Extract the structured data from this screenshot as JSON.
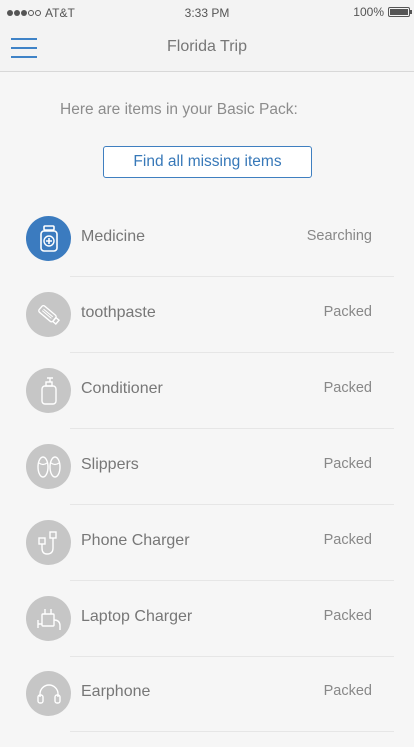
{
  "status_bar": {
    "carrier": "AT&T",
    "signal_bars_filled": 3,
    "signal_bars_total": 5,
    "time": "3:33 PM",
    "battery": "100%"
  },
  "nav": {
    "title": "Florida Trip",
    "menu_icon": "hamburger-menu-icon"
  },
  "intro_text": "Here are items in your Basic Pack:",
  "find_button_label": "Find all missing items",
  "colors": {
    "accent": "#3b7bbf",
    "icon_inactive": "#c6c6c6",
    "background": "#f6f6f6"
  },
  "items": [
    {
      "name": "Medicine",
      "status": "Searching",
      "icon": "medicine-bottle-icon",
      "active": true
    },
    {
      "name": "toothpaste",
      "status": "Packed",
      "icon": "toothpaste-icon",
      "active": false
    },
    {
      "name": "Conditioner",
      "status": "Packed",
      "icon": "conditioner-bottle-icon",
      "active": false
    },
    {
      "name": "Slippers",
      "status": "Packed",
      "icon": "slippers-icon",
      "active": false
    },
    {
      "name": "Phone Charger",
      "status": "Packed",
      "icon": "phone-charger-icon",
      "active": false
    },
    {
      "name": "Laptop Charger",
      "status": "Packed",
      "icon": "laptop-charger-icon",
      "active": false
    },
    {
      "name": "Earphone",
      "status": "Packed",
      "icon": "earphone-icon",
      "active": false
    }
  ]
}
